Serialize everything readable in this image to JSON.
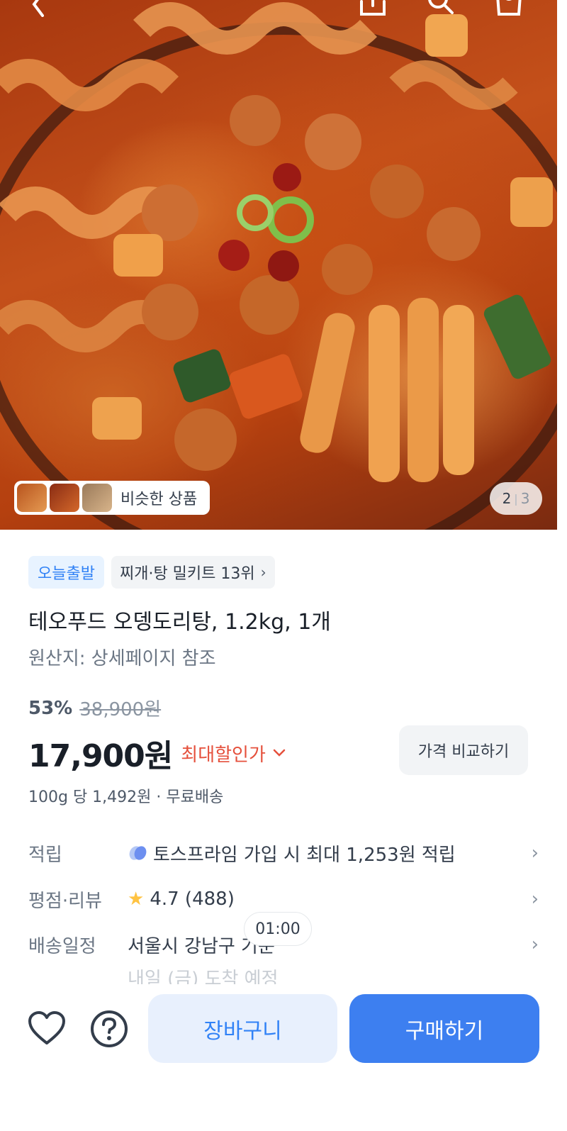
{
  "hero": {
    "similar_label": "비슷한 상품",
    "pager_current": "2",
    "pager_total": "3"
  },
  "badges": {
    "today_shipping": "오늘출발",
    "ranking": "찌개·탕 밀키트 13위",
    "ranking_chevron": "›"
  },
  "product": {
    "title": "테오푸드 오뎅도리탕, 1.2kg, 1개",
    "origin": "원산지: 상세페이지 참조",
    "discount": "53%",
    "original_price": "38,900원",
    "price": "17,900원",
    "max_discount_label": "최대할인가",
    "compare_label": "가격 비교하기",
    "unit_price": "100g 당 1,492원 · 무료배송"
  },
  "info": {
    "points_key": "적립",
    "points_value": "토스프라임 가입 시 최대 1,253원 적립",
    "rating_key": "평점·리뷰",
    "rating_value": "4.7 (488)",
    "delivery_key": "배송일정",
    "delivery_value": "서울시 강남구 기준",
    "delivery_next": "내일 (금) 도착 예정",
    "timer": "01:00"
  },
  "bottom": {
    "cart_label": "장바구니",
    "buy_label": "구매하기"
  },
  "icons": [
    "back-icon",
    "share-icon",
    "search-icon",
    "shopping-bag-icon",
    "heart-icon",
    "question-icon",
    "chevron-right-icon",
    "chevron-down-icon",
    "star-icon",
    "toss-prime-icon"
  ],
  "colors": {
    "accent_blue": "#3182f6",
    "buy_button": "#3d7ff0",
    "discount_red": "#e5503c",
    "star_yellow": "#ffc342"
  }
}
